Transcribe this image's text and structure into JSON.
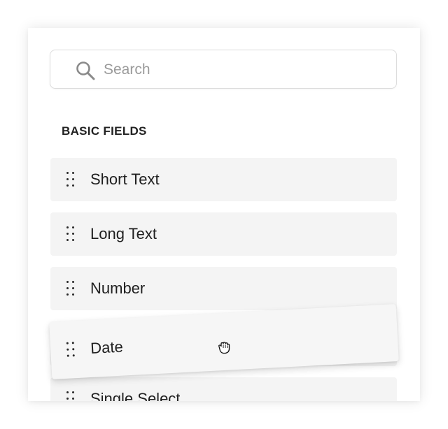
{
  "search": {
    "placeholder": "Search",
    "value": ""
  },
  "section": {
    "heading": "BASIC FIELDS"
  },
  "fields": [
    {
      "label": "Short Text",
      "icon": "drag-handle-icon"
    },
    {
      "label": "Long Text",
      "icon": "drag-handle-icon"
    },
    {
      "label": "Number",
      "icon": "drag-handle-icon"
    },
    {
      "label": "Date",
      "icon": "drag-handle-icon",
      "state": "dragging"
    },
    {
      "label": "Single Select",
      "icon": "drag-handle-icon"
    }
  ],
  "cursor": {
    "icon": "grab-hand-icon"
  },
  "colors": {
    "item_background": "#f4f4f4",
    "text": "#1f1f1f",
    "placeholder": "#9a9a9a",
    "border": "#dcdcdc"
  }
}
